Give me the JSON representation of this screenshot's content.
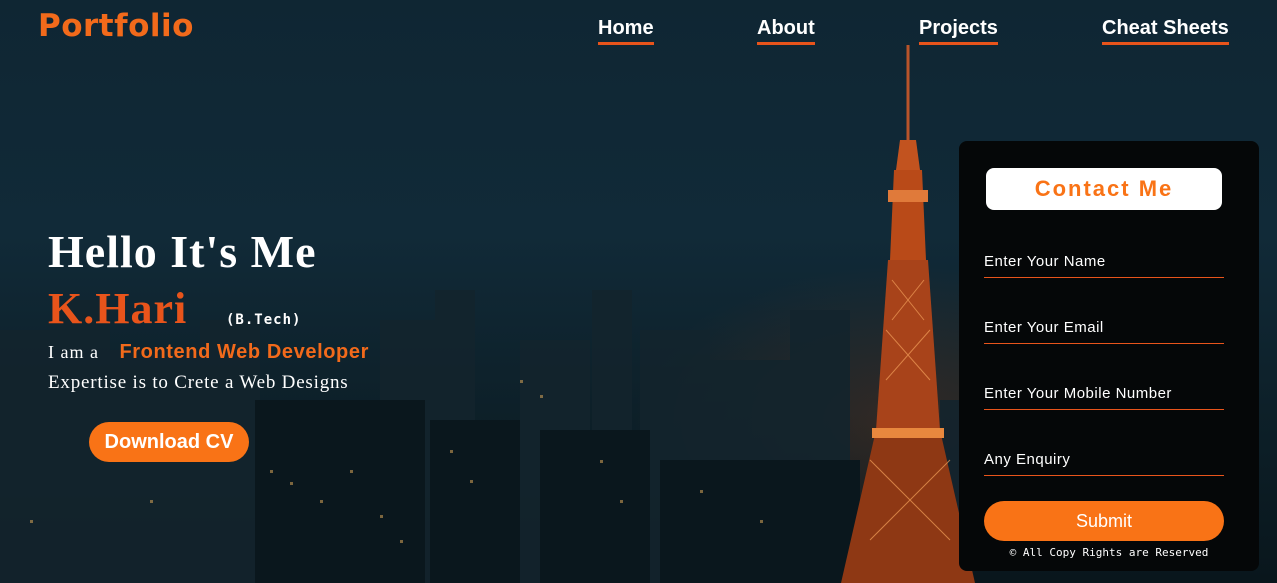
{
  "header": {
    "logo": "Portfolio",
    "nav": [
      "Home",
      "About",
      "Projects",
      "Cheat Sheets"
    ]
  },
  "hero": {
    "greeting": "Hello It's Me",
    "name": "K.Hari",
    "degree": "(B.Tech)",
    "iam": "I am a",
    "role": "Frontend Web Developer",
    "expertise": "Expertise is to Crete a Web Designs",
    "download_label": "Download CV"
  },
  "contact": {
    "title": "Contact Me",
    "name_placeholder": "Enter Your Name",
    "email_placeholder": "Enter Your Email",
    "mobile_placeholder": "Enter Your Mobile Number",
    "enquiry_placeholder": "Any Enquiry",
    "submit_label": "Submit",
    "copyright": "© All Copy Rights are Reserved"
  },
  "colors": {
    "accent": "#f26a1b",
    "button": "#f97316",
    "panel": "#050708",
    "background": "#0e2330"
  }
}
